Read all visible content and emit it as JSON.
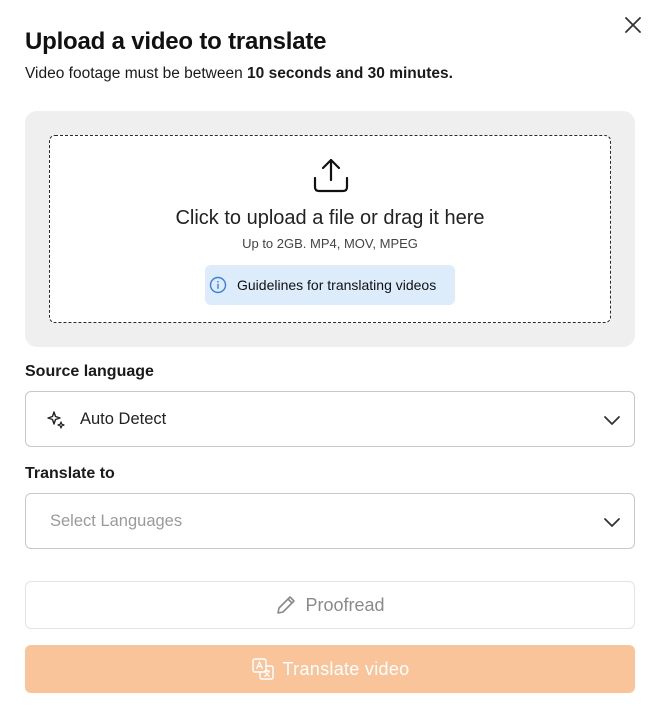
{
  "dialog": {
    "title": "Upload a video to translate",
    "subtitle_prefix": "Video footage must be between ",
    "subtitle_bold": "10 seconds and 30 minutes."
  },
  "upload": {
    "title": "Click to upload a file or drag it here",
    "hint": "Up to 2GB. MP4, MOV, MPEG",
    "guidelines_label": "Guidelines for translating videos"
  },
  "source_language": {
    "label": "Source language",
    "value": "Auto Detect"
  },
  "translate_to": {
    "label": "Translate to",
    "placeholder": "Select Languages"
  },
  "actions": {
    "proofread_label": "Proofread",
    "translate_label": "Translate video"
  },
  "colors": {
    "accent_disabled": "#f9c49a",
    "info_bg": "#dcecfb",
    "info_icon": "#3b7ddd"
  },
  "icons": [
    "close-icon",
    "upload-icon",
    "info-icon",
    "sparkle-icon",
    "chevron-down-icon",
    "pencil-icon",
    "translate-icon"
  ]
}
